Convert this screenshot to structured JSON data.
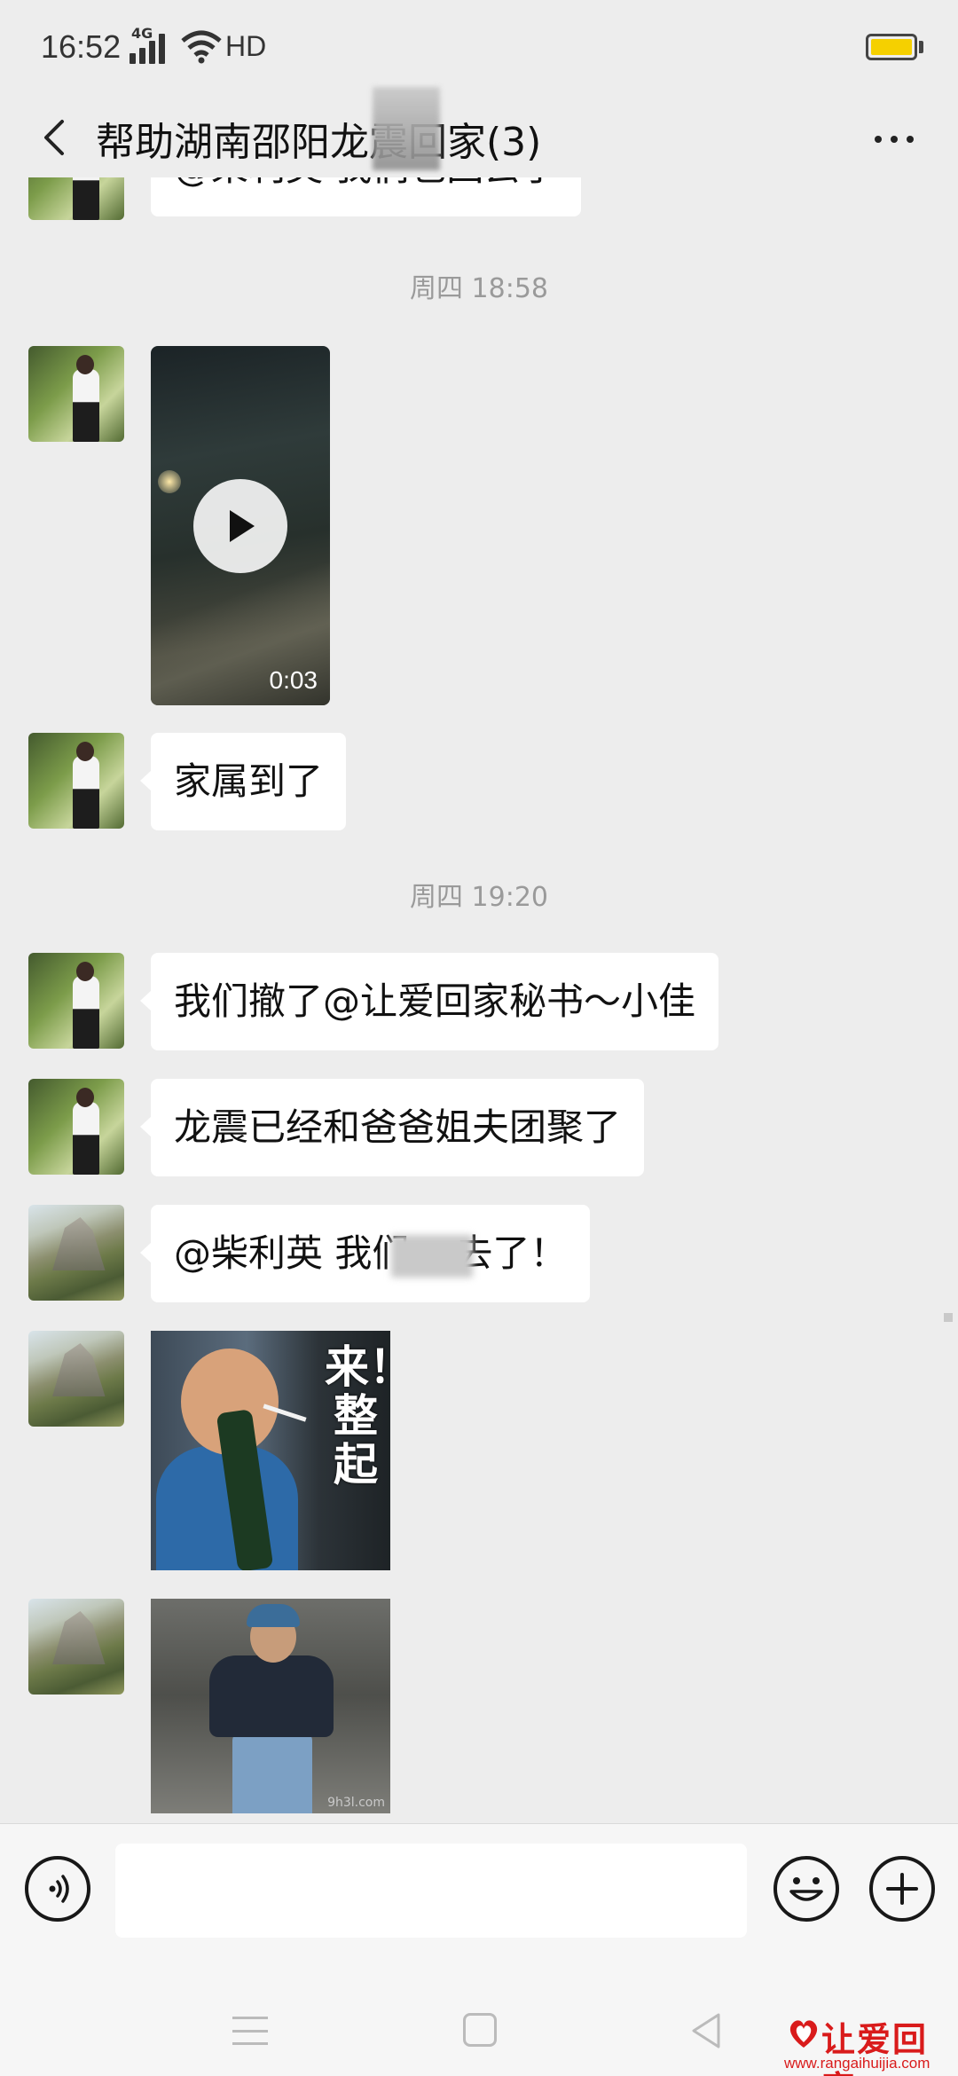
{
  "status_bar": {
    "time": "16:52",
    "network": "4G",
    "hd": "HD",
    "battery_color": "#f5d000"
  },
  "title_bar": {
    "title": "帮助湖南邵阳龙震回家(3)",
    "back_icon": "chevron-left-icon",
    "more_icon": "more-dots-icon"
  },
  "chat": {
    "top_partial_bubble": "@柴利英 我们也回去了",
    "timestamp_1": "周四 18:58",
    "video": {
      "duration": "0:03"
    },
    "msg_family_arrived": "家属到了",
    "timestamp_2": "周四 19:20",
    "msg_withdraw": "我们撤了@让爱回家秘书～小佳",
    "msg_reunited": "龙震已经和爸爸姐夫团聚了",
    "msg_going_back_prefix": "@柴利英  我们",
    "msg_going_back_suffix": "去了！",
    "sticker_1_text": "来！整起",
    "sticker_2_watermark": "9h3l.com"
  },
  "input_bar": {
    "placeholder": "",
    "voice_icon": "voice-icon",
    "emoji_icon": "emoji-icon",
    "plus_icon": "plus-icon"
  },
  "watermark": {
    "brand": "让爱回家",
    "url": "www.rangaihuijia.com"
  },
  "colors": {
    "background": "#ededed",
    "bubble": "#ffffff",
    "timestamp": "#9a9a9a",
    "watermark": "#d91b1b"
  }
}
